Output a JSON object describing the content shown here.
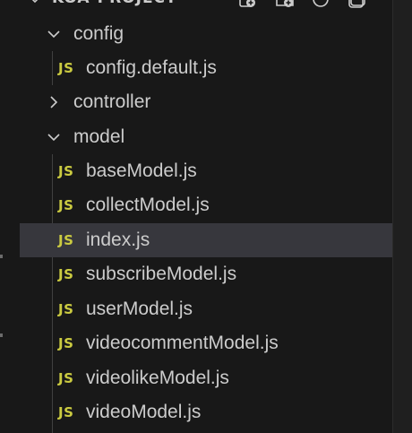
{
  "explorer": {
    "project_title": "KOA-PROJECT",
    "header_actions": [
      {
        "name": "new-file-icon"
      },
      {
        "name": "new-folder-icon"
      },
      {
        "name": "refresh-icon"
      },
      {
        "name": "collapse-all-icon"
      }
    ],
    "tree": [
      {
        "kind": "folder",
        "label": "config",
        "expanded": true,
        "depth": 0
      },
      {
        "kind": "file",
        "label": "config.default.js",
        "badge": "JS",
        "depth": 1
      },
      {
        "kind": "folder",
        "label": "controller",
        "expanded": false,
        "depth": 0
      },
      {
        "kind": "folder",
        "label": "model",
        "expanded": true,
        "depth": 0
      },
      {
        "kind": "file",
        "label": "baseModel.js",
        "badge": "JS",
        "depth": 1
      },
      {
        "kind": "file",
        "label": "collectModel.js",
        "badge": "JS",
        "depth": 1
      },
      {
        "kind": "file",
        "label": "index.js",
        "badge": "JS",
        "depth": 1,
        "selected": true
      },
      {
        "kind": "file",
        "label": "subscribeModel.js",
        "badge": "JS",
        "depth": 1
      },
      {
        "kind": "file",
        "label": "userModel.js",
        "badge": "JS",
        "depth": 1
      },
      {
        "kind": "file",
        "label": "videocommentModel.js",
        "badge": "JS",
        "depth": 1
      },
      {
        "kind": "file",
        "label": "videolikeModel.js",
        "badge": "JS",
        "depth": 1
      },
      {
        "kind": "file",
        "label": "videoModel.js",
        "badge": "JS",
        "depth": 1
      }
    ]
  },
  "colors": {
    "background": "#181818",
    "selected_row": "#37373d",
    "text": "#cccccc",
    "js_badge": "#cbcb41"
  }
}
